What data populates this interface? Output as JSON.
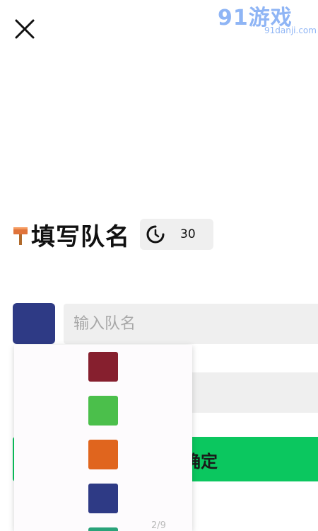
{
  "watermark": {
    "main": "91游戏",
    "sub": "91danji.com"
  },
  "header": {
    "title": "填写队名",
    "timer_value": "30"
  },
  "form": {
    "selected_color": "#2e3a85",
    "team_name_placeholder": "输入队名",
    "confirm_label": "确定"
  },
  "color_dropdown": {
    "options": [
      {
        "color": "#861f2e"
      },
      {
        "color": "#4bbf4b"
      },
      {
        "color": "#e0651e"
      },
      {
        "color": "#2e3a85"
      },
      {
        "color": "#2aa37a"
      }
    ],
    "page_indicator": "2/9"
  },
  "colors": {
    "accent_green": "#0bc75f",
    "field_gray": "#efefef"
  }
}
